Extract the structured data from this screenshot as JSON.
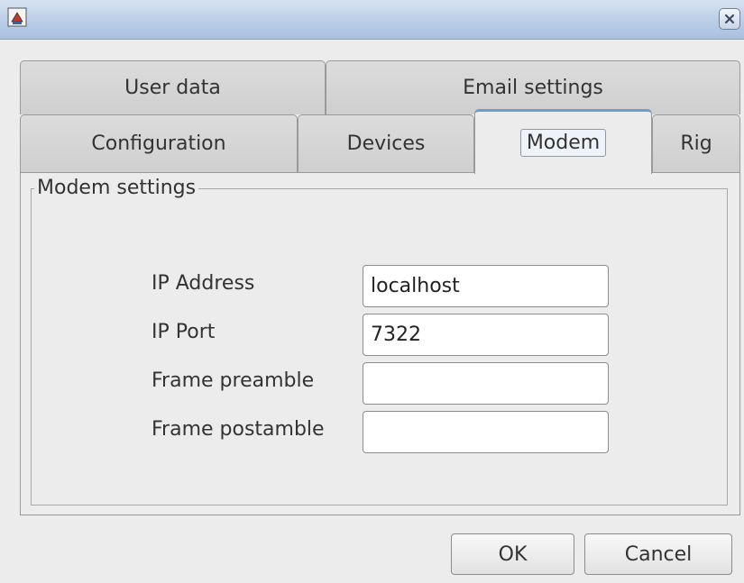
{
  "window": {
    "title": ""
  },
  "icons": {
    "app": "java-app-icon",
    "close": "close-icon"
  },
  "tabs": {
    "row1": [
      {
        "label": "User data"
      },
      {
        "label": "Email settings"
      }
    ],
    "row2": [
      {
        "label": "Configuration"
      },
      {
        "label": "Devices"
      },
      {
        "label": "Modem",
        "selected": true
      },
      {
        "label": "Rig"
      }
    ]
  },
  "modem_settings": {
    "legend": "Modem settings",
    "fields": [
      {
        "label": "IP Address",
        "value": "localhost"
      },
      {
        "label": "IP Port",
        "value": "7322"
      },
      {
        "label": "Frame preamble",
        "value": ""
      },
      {
        "label": "Frame postamble",
        "value": ""
      }
    ]
  },
  "buttons": {
    "ok": "OK",
    "cancel": "Cancel"
  },
  "colors": {
    "accent": "#6f9ad6",
    "titlebar": "#b8cce6"
  }
}
